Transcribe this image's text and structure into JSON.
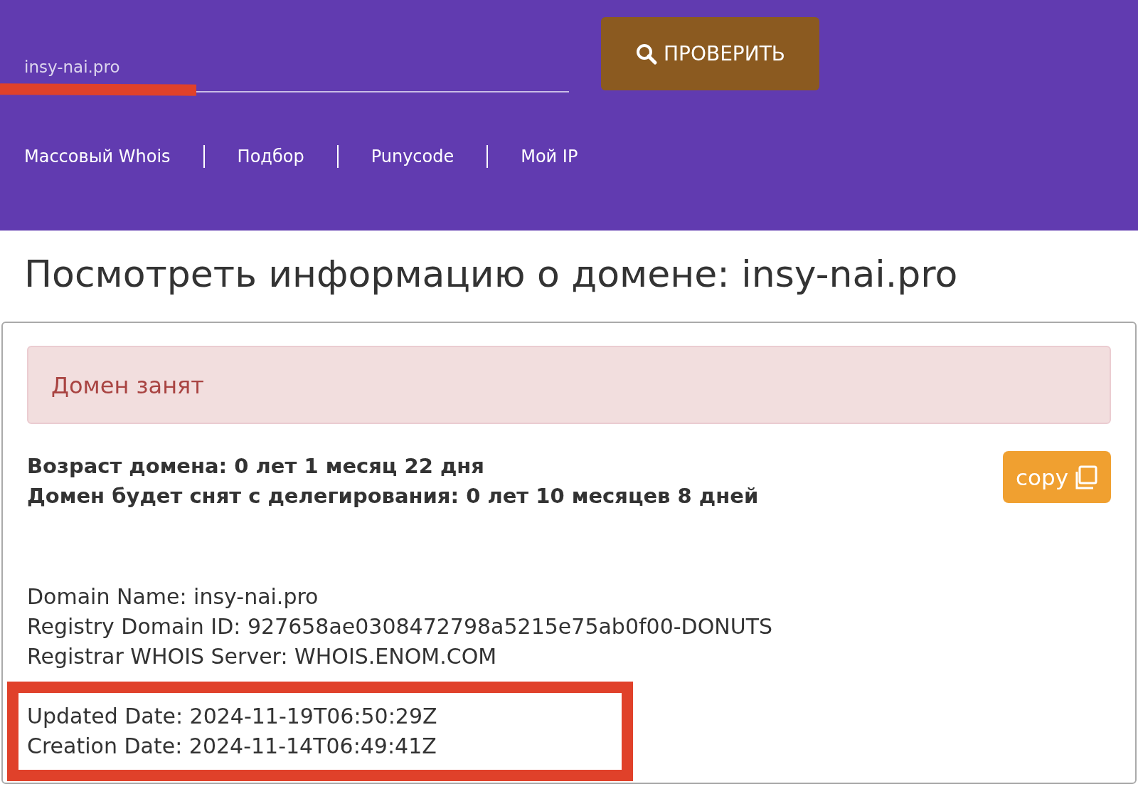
{
  "search": {
    "value": "insy-nai.pro",
    "button": "ПРОВЕРИТЬ"
  },
  "nav": [
    "Массовый Whois",
    "Подбор",
    "Punycode",
    "Мой IP"
  ],
  "title": "Посмотреть информацию о домене: insy-nai.pro",
  "alert": "Домен занят",
  "age_lines": [
    "Возраст домена: 0 лет 1 месяц 22 дня",
    "Домен будет снят с делегирования: 0 лет 10 месяцев 8 дней"
  ],
  "copy_button": "copy",
  "whois_lines": [
    "Domain Name: insy-nai.pro",
    "Registry Domain ID: 927658ae0308472798a5215e75ab0f00-DONUTS",
    "Registrar WHOIS Server: WHOIS.ENOM.COM"
  ],
  "highlighted_lines": [
    "Updated Date: 2024-11-19T06:50:29Z",
    "Creation Date: 2024-11-14T06:49:41Z"
  ]
}
